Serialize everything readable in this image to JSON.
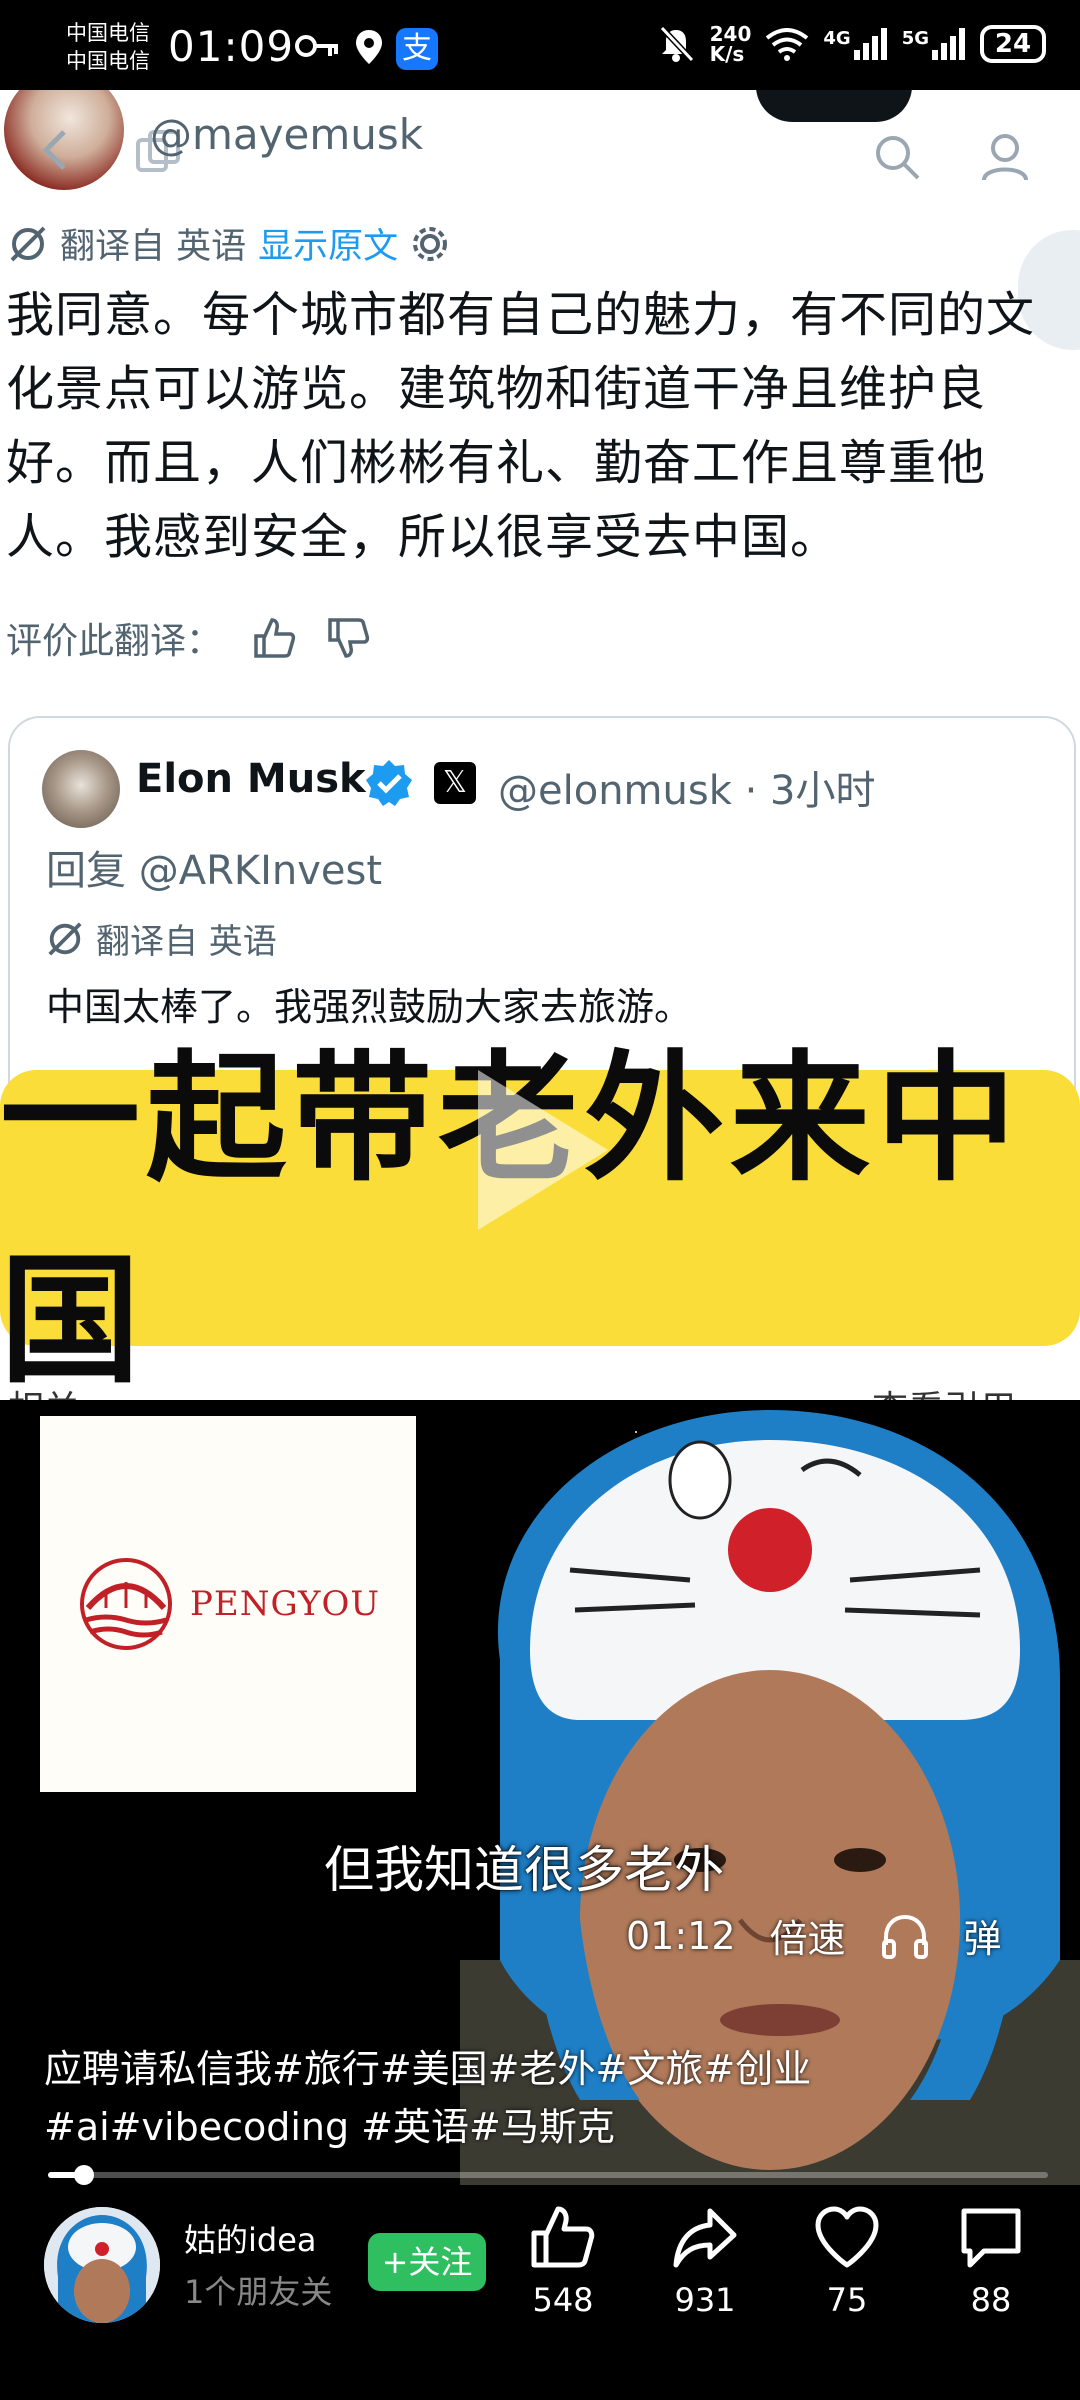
{
  "status_bar": {
    "carrier1": "中国电信",
    "carrier2": "中国电信",
    "time": "01:09",
    "net_speed_value": "240",
    "net_speed_unit": "K/s",
    "signal1": "4G",
    "signal2": "5G",
    "battery": "24"
  },
  "tweet": {
    "handle": "@mayemusk",
    "translate_from": "翻译自 英语",
    "show_original": "显示原文",
    "body": "我同意。每个城市都有自己的魅力，有不同的文化景点可以游览。建筑物和街道干净且维护良好。而且，人们彬彬有礼、勤奋工作且尊重他人。我感到安全，所以很享受去中国。",
    "rate_label": "评价此翻译："
  },
  "quote": {
    "name": "Elon Musk",
    "handle_time": "@elonmusk · 3小时",
    "reply_to": "回复 @ARKInvest",
    "translate_from": "翻译自 英语",
    "text": "中国太棒了。我强烈鼓励大家去旅游。"
  },
  "banner": {
    "text": "一起带老外来中国"
  },
  "hidden_row": {
    "left": "相关",
    "right": "查看引用"
  },
  "video": {
    "logo_text": "PENGYOU",
    "subtitle": "但我知道很多老外",
    "time": "01:12",
    "speed_label": "倍速",
    "danmu_label": "弹",
    "caption": "应聘请私信我#旅行#美国#老外#文旅#创业 #ai#vibecoding #英语#马斯克",
    "progress": 0.03
  },
  "author": {
    "name": "姑的idea",
    "sub": "1个朋友关",
    "follow_label": "+关注"
  },
  "actions": {
    "like": "548",
    "share": "931",
    "favorite": "75",
    "comment": "88"
  }
}
